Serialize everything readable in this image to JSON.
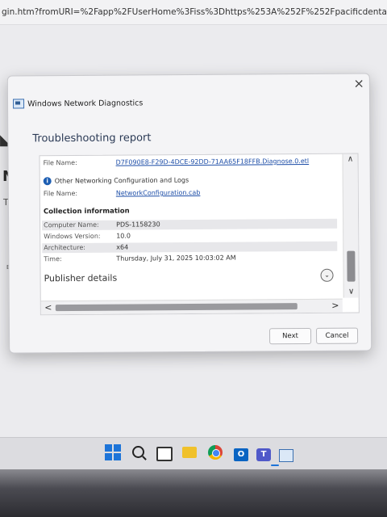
{
  "browser": {
    "url": "gin.htm?fromURI=%2Fapp%2FUserHome%3Fiss%3Dhttps%253A%252F%252Fpacificdental.okta...",
    "bg_n": "N",
    "bg_tr": "Tr",
    "bg_eu": "EU"
  },
  "dialog": {
    "app_title": "Windows Network Diagnostics",
    "report_title": "Troubleshooting report",
    "close_glyph": "×",
    "file_name_label": "File Name:",
    "file_name_value": "D7F090E8-F29D-4DCE-92DD-71AA65F18FFB.Diagnose.0.etl",
    "other_config_label": "Other Networking Configuration and Logs",
    "file_name2_label": "File Name:",
    "file_name2_value": "NetworkConfiguration.cab",
    "collection_title": "Collection information",
    "collection": [
      {
        "label": "Computer Name:",
        "value": "PDS-1158230"
      },
      {
        "label": "Windows Version:",
        "value": "10.0"
      },
      {
        "label": "Architecture:",
        "value": "x64"
      },
      {
        "label": "Time:",
        "value": "Thursday, July 31, 2025 10:03:02 AM"
      }
    ],
    "publisher_label": "Publisher details",
    "next_label": "Next",
    "cancel_label": "Cancel"
  },
  "icons": {
    "info": "i",
    "expand": "⌄",
    "scroll_up": "∧",
    "scroll_down": "∨",
    "scroll_left": "<",
    "scroll_right": ">",
    "outlook": "O",
    "teams": "T"
  }
}
